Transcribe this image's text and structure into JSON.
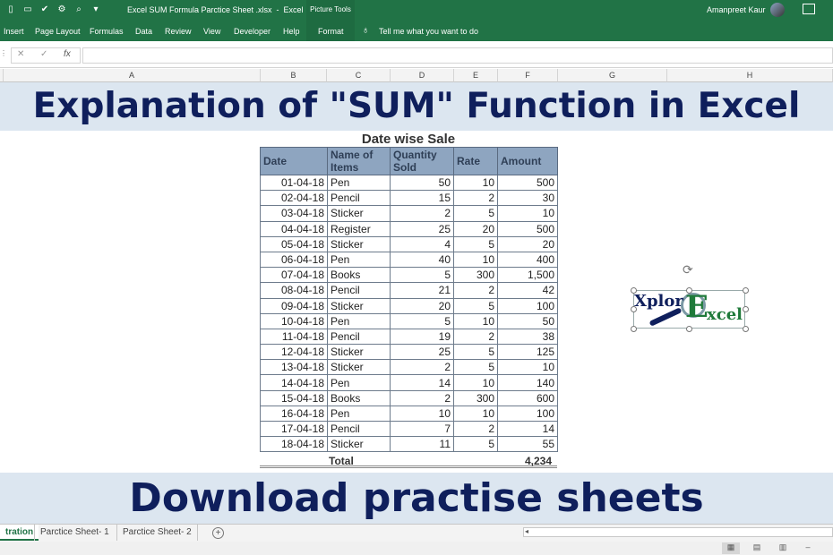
{
  "titlebar": {
    "filename": "Excel SUM Formula Parctice Sheet .xlsx  -  Excel",
    "picture_tools": "Picture Tools",
    "user": "Amanpreet Kaur"
  },
  "ribbon": {
    "tabs": [
      "Insert",
      "Page Layout",
      "Formulas",
      "Data",
      "Review",
      "View",
      "Developer",
      "Help",
      "Format"
    ],
    "tell_me": "Tell me what you want to do"
  },
  "formula_bar": {
    "cancel": "✕",
    "enter": "✓",
    "fx": "fx",
    "value": ""
  },
  "columns": [
    "A",
    "B",
    "C",
    "D",
    "E",
    "F",
    "G",
    "H"
  ],
  "banner_top": "Explanation of \"SUM\" Function in Excel",
  "banner_bottom": "Download practise sheets",
  "table": {
    "title": "Date wise Sale",
    "headers": [
      "Date",
      "Name of Items",
      "Quantity Sold",
      "Rate",
      "Amount"
    ],
    "rows": [
      [
        "01-04-18",
        "Pen",
        "50",
        "10",
        "500"
      ],
      [
        "02-04-18",
        "Pencil",
        "15",
        "2",
        "30"
      ],
      [
        "03-04-18",
        "Sticker",
        "2",
        "5",
        "10"
      ],
      [
        "04-04-18",
        "Register",
        "25",
        "20",
        "500"
      ],
      [
        "05-04-18",
        "Sticker",
        "4",
        "5",
        "20"
      ],
      [
        "06-04-18",
        "Pen",
        "40",
        "10",
        "400"
      ],
      [
        "07-04-18",
        "Books",
        "5",
        "300",
        "1,500"
      ],
      [
        "08-04-18",
        "Pencil",
        "21",
        "2",
        "42"
      ],
      [
        "09-04-18",
        "Sticker",
        "20",
        "5",
        "100"
      ],
      [
        "10-04-18",
        "Pen",
        "5",
        "10",
        "50"
      ],
      [
        "11-04-18",
        "Pencil",
        "19",
        "2",
        "38"
      ],
      [
        "12-04-18",
        "Sticker",
        "25",
        "5",
        "125"
      ],
      [
        "13-04-18",
        "Sticker",
        "2",
        "5",
        "10"
      ],
      [
        "14-04-18",
        "Pen",
        "14",
        "10",
        "140"
      ],
      [
        "15-04-18",
        "Books",
        "2",
        "300",
        "600"
      ],
      [
        "16-04-18",
        "Pen",
        "10",
        "10",
        "100"
      ],
      [
        "17-04-18",
        "Pencil",
        "7",
        "2",
        "14"
      ],
      [
        "18-04-18",
        "Sticker",
        "11",
        "5",
        "55"
      ]
    ],
    "total_label": "Total",
    "total_value": "4,234"
  },
  "logo": {
    "xplor": "Xplor",
    "e": "E",
    "xcel": "xcel"
  },
  "sheets": {
    "active": "tration",
    "tabs": [
      "Parctice Sheet- 1",
      "Parctice Sheet- 2"
    ],
    "add": "+"
  },
  "colors": {
    "excel_green": "#217346",
    "banner_bg": "#dce6f0",
    "banner_text": "#0f1f5c",
    "table_header_bg": "#8ea5c0"
  }
}
